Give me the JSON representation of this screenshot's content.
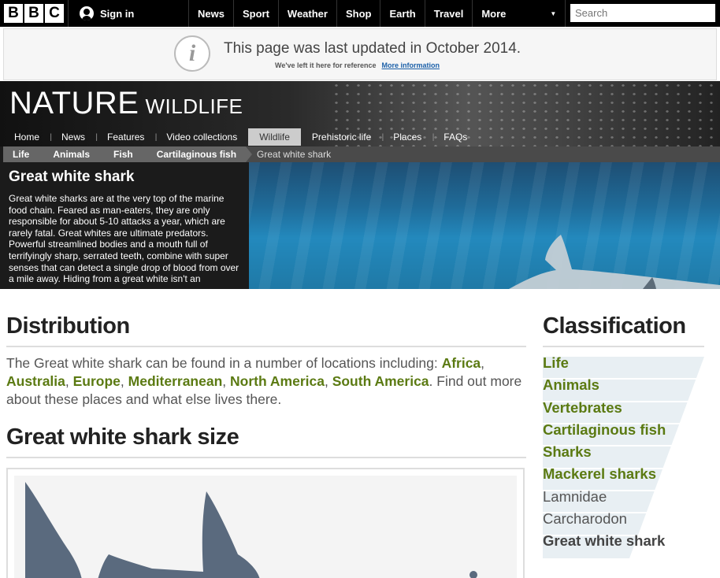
{
  "topbar": {
    "logo_letters": [
      "B",
      "B",
      "C"
    ],
    "signin_label": "Sign in",
    "nav": [
      "News",
      "Sport",
      "Weather",
      "Shop",
      "Earth",
      "Travel"
    ],
    "more_label": "More",
    "search_placeholder": "Search"
  },
  "notice": {
    "headline": "This page was last updated in October 2014.",
    "sub": "We've left it here for reference",
    "link": "More information"
  },
  "nature": {
    "title": "NATURE",
    "subtitle": "WILDLIFE",
    "subnav": [
      "Home",
      "News",
      "Features",
      "Video collections",
      "Wildlife",
      "Prehistoric life",
      "Places",
      "FAQs"
    ],
    "active": "Wildlife",
    "breadcrumbs": [
      "Life",
      "Animals",
      "Fish",
      "Cartilaginous fish"
    ],
    "breadcrumb_current": "Great white shark",
    "feature_title": "Great white shark",
    "feature_text": "Great white sharks are at the very top of the marine food chain. Feared as man-eaters, they are only responsible for about 5-10 attacks a year, which are rarely fatal. Great whites are ultimate predators. Powerful streamlined bodies and a mouth full of terrifyingly sharp, serrated teeth, combine with super senses that can detect a single drop of blood from over a mile away. Hiding from a great white isn't an"
  },
  "distribution": {
    "heading": "Distribution",
    "intro": "The Great white shark can be found in a number of locations including:",
    "locations": [
      "Africa",
      "Australia",
      "Europe",
      "Mediterranean",
      "North America",
      "South America"
    ],
    "outro": ". Find out more about these places and what else lives there."
  },
  "size": {
    "heading": "Great white shark size"
  },
  "classification": {
    "heading": "Classification",
    "linked": [
      "Life",
      "Animals",
      "Vertebrates",
      "Cartilaginous fish",
      "Sharks",
      "Mackerel sharks"
    ],
    "plain": [
      "Lamnidae",
      "Carcharodon"
    ],
    "current": "Great white shark"
  },
  "colors": {
    "link_green": "#5b7a12",
    "bbc_black": "#000000",
    "water_blue": "#2389bd",
    "silhouette": "#5a6a7e"
  }
}
